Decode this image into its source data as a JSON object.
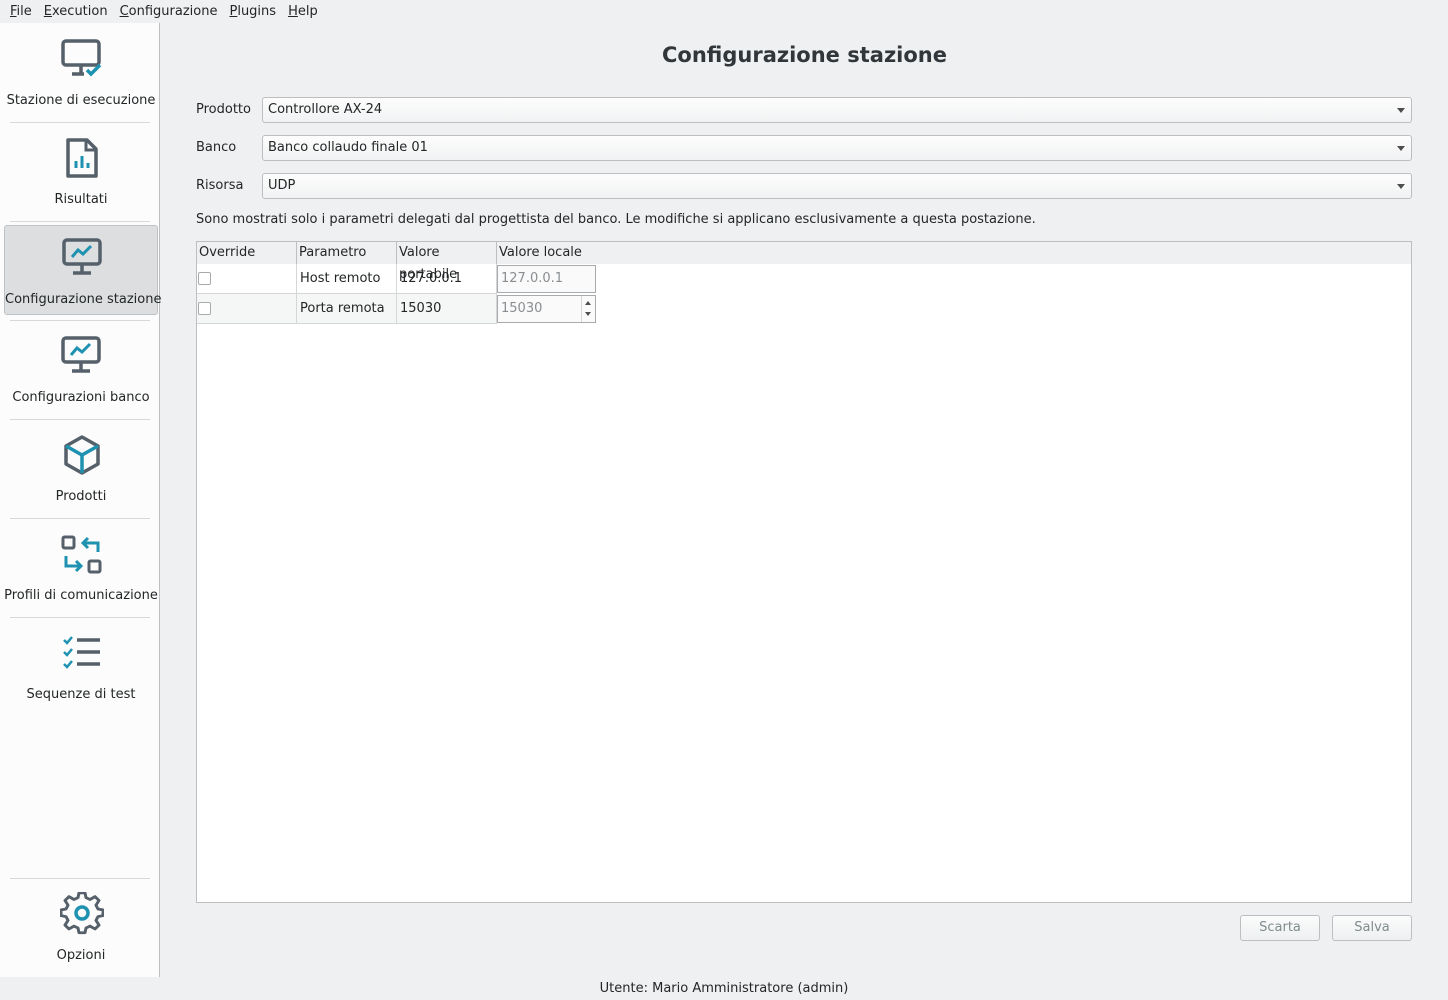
{
  "menu": [
    {
      "mnemonic": "F",
      "rest": "ile"
    },
    {
      "mnemonic": "E",
      "rest": "xecution"
    },
    {
      "mnemonic": "C",
      "rest": "onfigurazione"
    },
    {
      "mnemonic": "P",
      "rest": "lugins"
    },
    {
      "mnemonic": "H",
      "rest": "elp"
    }
  ],
  "sidebar": {
    "items": [
      {
        "label": "Stazione di esecuzione",
        "icon": "monitor-check-icon"
      },
      {
        "label": "Risultati",
        "icon": "report-icon"
      },
      {
        "label": "Configurazione stazione",
        "icon": "monitor-chart-icon",
        "active": true
      },
      {
        "label": "Configurazioni banco",
        "icon": "monitor-chart-icon"
      },
      {
        "label": "Prodotti",
        "icon": "cube-icon"
      },
      {
        "label": "Profili di comunicazione",
        "icon": "swap-icon"
      },
      {
        "label": "Sequenze di test",
        "icon": "checklist-icon"
      }
    ],
    "options": {
      "label": "Opzioni",
      "icon": "gear-icon"
    }
  },
  "page": {
    "title": "Configurazione stazione",
    "fields": [
      {
        "label": "Prodotto",
        "value": "Controllore AX-24"
      },
      {
        "label": "Banco",
        "value": "Banco collaudo finale 01"
      },
      {
        "label": "Risorsa",
        "value": "UDP"
      }
    ],
    "note": "Sono mostrati solo i parametri delegati dal progettista del banco. Le modifiche si applicano esclusivamente a questa postazione.",
    "table": {
      "headers": [
        "Override",
        "Parametro",
        "Valore portabile",
        "Valore locale"
      ],
      "rows": [
        {
          "parameter": "Host remoto",
          "portable": "127.0.0.1",
          "local": "127.0.0.1"
        },
        {
          "parameter": "Porta remota",
          "portable": "15030",
          "local": "15030"
        }
      ]
    },
    "buttons": {
      "discard": "Scarta",
      "save": "Salva"
    }
  },
  "status": {
    "user": "Utente: Mario Amministratore (admin)"
  },
  "colors": {
    "accent": "#1e92b0",
    "icon_gray": "#55606a"
  }
}
